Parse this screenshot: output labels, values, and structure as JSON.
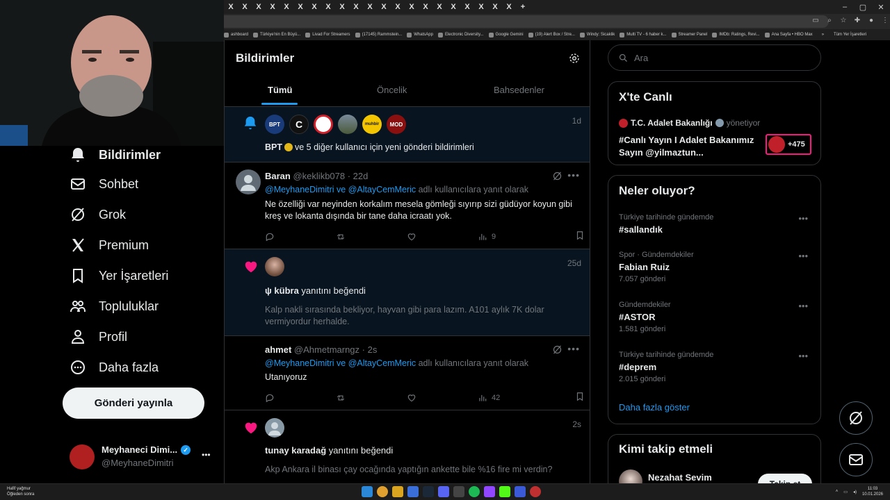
{
  "browser": {
    "tab_glyph": "X",
    "bookmarks": [
      "ashboard",
      "Türkiye'nin En Büyü...",
      "Livad For Streamers",
      "(17145) Rammstein...",
      "WhatsApp",
      "Electronic Diversity...",
      "Google Gemini",
      "(19) Alert Box / Stre...",
      "Windy: Sicaklik",
      "Multi TV - 6 haber k...",
      "Streamer Panel",
      "IMDb: Ratings, Revi...",
      "Ana Sayfa • HBO Max"
    ],
    "bookmarks_more": "»",
    "all_bookmarks": "Tüm Yer İşaretleri"
  },
  "nav": {
    "items": [
      {
        "label": "Bildirimler",
        "icon": "bell-icon"
      },
      {
        "label": "Sohbet",
        "icon": "mail-icon"
      },
      {
        "label": "Grok",
        "icon": "grok-icon"
      },
      {
        "label": "Premium",
        "icon": "x-logo-icon"
      },
      {
        "label": "Yer İşaretleri",
        "icon": "bookmark-icon"
      },
      {
        "label": "Topluluklar",
        "icon": "people-icon"
      },
      {
        "label": "Profil",
        "icon": "person-icon"
      },
      {
        "label": "Daha fazla",
        "icon": "more-circle-icon"
      }
    ],
    "post_button": "Gönderi yayınla",
    "profile": {
      "name": "Meyhaneci Dimi...",
      "handle": "@MeyhaneDimitri",
      "more": "•••"
    }
  },
  "main": {
    "title": "Bildirimler",
    "tabs": [
      "Tümü",
      "Öncelik",
      "Bahsedenler"
    ],
    "active_tab": 0,
    "notif1": {
      "text_bold": "BPT",
      "text": " ve 5 diğer kullanıcı için yeni gönderi bildirimleri",
      "time": "1d",
      "avatars": [
        "BPT",
        "C",
        "",
        "",
        "muhbir",
        "MOD"
      ]
    },
    "reply1": {
      "name": "Baran",
      "handle": "@keklikb078",
      "time": "· 22d",
      "replying_to_1": "@MeyhaneDimitri",
      "and": " ve ",
      "replying_to_2": "@AltayCemMeric",
      "replying_suffix": " adlı kullanıcılara yanıt olarak",
      "text": "Ne özelliği var neyinden korkalım mesela gömleği sıyırıp sizi güdüyor koyun gibi kreş ve lokanta dışında bir tane daha icraatı yok.",
      "views": "9"
    },
    "like1": {
      "name": "ψ kübra",
      "action": " yanıtını beğendi",
      "time": "25d",
      "quote": "Kalp nakli sırasında bekliyor, hayvan gibi para lazım. A101 aylık 7K dolar vermiyordur herhalde."
    },
    "reply2": {
      "name": "ahmet",
      "handle": "@Ahmetmarngz",
      "time": "· 2s",
      "replying_to_1": "@MeyhaneDimitri",
      "and": " ve ",
      "replying_to_2": "@AltayCemMeric",
      "replying_suffix": " adlı kullanıcılara yanıt olarak",
      "text": "Utanıyoruz",
      "views": "42"
    },
    "like2": {
      "name": "tunay karadağ",
      "action": " yanıtını beğendi",
      "time": "2s",
      "quote": "Akp Ankara il binası çay ocağında yaptığın ankette bile %16 fire mi verdin?"
    }
  },
  "right": {
    "search_placeholder": "Ara",
    "live": {
      "title": "X'te Canlı",
      "host": "T.C. Adalet Bakanlığı",
      "role": "yönetiyor",
      "text": "#Canlı Yayın I Adalet Bakanımız Sayın @yilmaztun...",
      "count": "+475"
    },
    "trends": {
      "title": "Neler oluyor?",
      "items": [
        {
          "category": "Türkiye tarihinde gündemde",
          "name": "#sallandık",
          "count": ""
        },
        {
          "category": "Spor · Gündemdekiler",
          "name": "Fabian Ruiz",
          "count": "7.057 gönderi"
        },
        {
          "category": "Gündemdekiler",
          "name": "#ASTOR",
          "count": "1.581 gönderi"
        },
        {
          "category": "Türkiye tarihinde gündemde",
          "name": "#deprem",
          "count": "2.015 gönderi"
        }
      ],
      "show_more": "Daha fazla göster"
    },
    "who_to_follow": {
      "title": "Kimi takip etmeli",
      "name": "Nezahat Sevim",
      "button": "Takip et"
    }
  },
  "taskbar": {
    "weather": "Hafif yağmur",
    "weather_sub": "Öğleden sonra",
    "time": "11:03",
    "date": "10.01.2026"
  },
  "colors": {
    "accent": "#1d9bf0",
    "like": "#f91880",
    "bg": "#000000",
    "border": "#2f3336"
  }
}
